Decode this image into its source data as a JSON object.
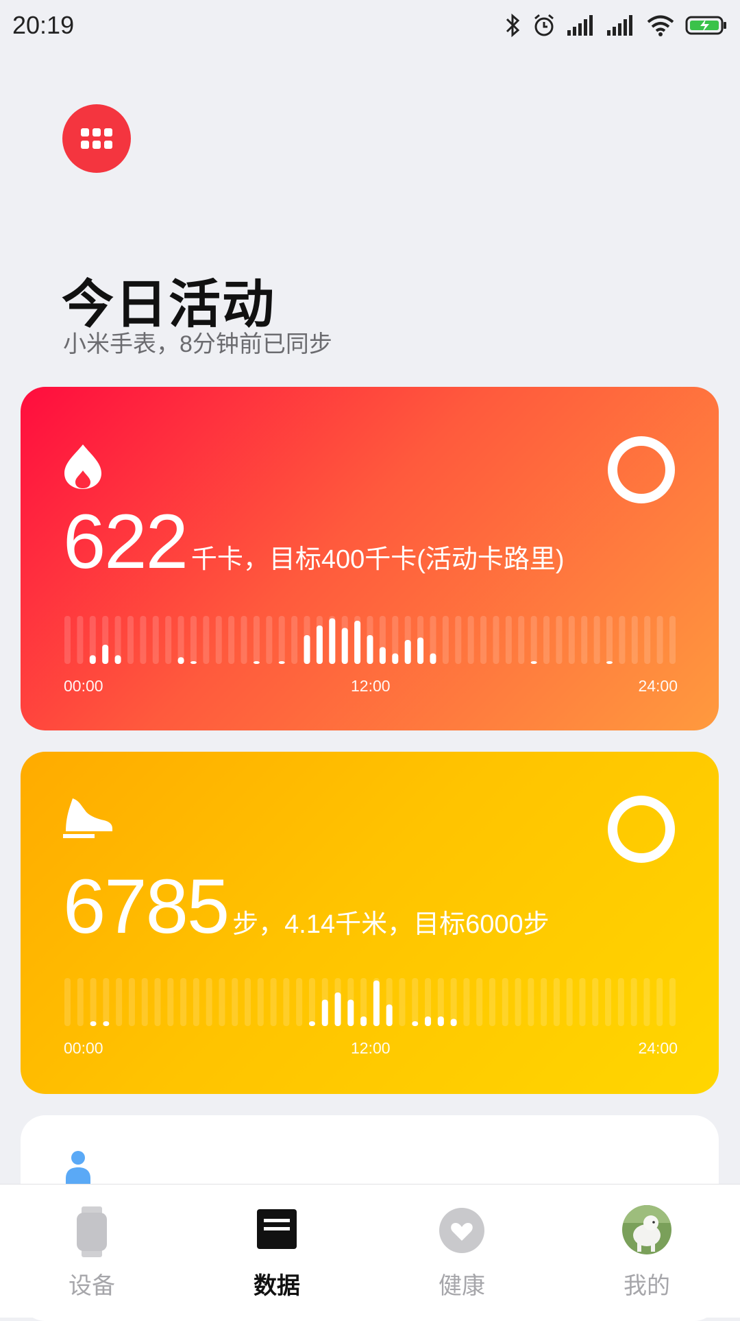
{
  "status": {
    "time": "20:19"
  },
  "header": {
    "title": "今日活动",
    "subtitle": "小米手表，8分钟前已同步"
  },
  "calorie_card": {
    "value": "622",
    "unit_text": "千卡，目标400千卡(活动卡路里)",
    "ticks": [
      "00:00",
      "12:00",
      "24:00"
    ],
    "bars": [
      0,
      0,
      0.18,
      0.4,
      0.18,
      0,
      0,
      0,
      0,
      0.14,
      0.05,
      0,
      0,
      0,
      0,
      0.05,
      0,
      0.05,
      0,
      0.6,
      0.8,
      0.95,
      0.75,
      0.9,
      0.6,
      0.35,
      0.22,
      0.5,
      0.55,
      0.22,
      0,
      0,
      0,
      0,
      0,
      0,
      0,
      0.05,
      0,
      0,
      0,
      0,
      0,
      0.05,
      0,
      0,
      0,
      0,
      0
    ],
    "accent": "#ff3344"
  },
  "steps_card": {
    "value": "6785",
    "unit_text": "步，4.14千米，目标6000步",
    "ticks": [
      "00:00",
      "12:00",
      "24:00"
    ],
    "bars": [
      0,
      0,
      0.1,
      0.1,
      0,
      0,
      0,
      0,
      0,
      0,
      0,
      0,
      0,
      0,
      0,
      0,
      0,
      0,
      0,
      0.1,
      0.55,
      0.7,
      0.55,
      0.2,
      0.95,
      0.45,
      0,
      0.1,
      0.2,
      0.2,
      0.15,
      0,
      0,
      0,
      0,
      0,
      0,
      0,
      0,
      0,
      0,
      0,
      0,
      0,
      0,
      0,
      0,
      0
    ],
    "accent": "#ffc000"
  },
  "bottom_nav": {
    "items": [
      {
        "label": "设备",
        "icon": "watch-icon",
        "active": false
      },
      {
        "label": "数据",
        "icon": "data-icon",
        "active": true
      },
      {
        "label": "健康",
        "icon": "heart-icon",
        "active": false
      },
      {
        "label": "我的",
        "icon": "avatar-icon",
        "active": false
      }
    ]
  }
}
